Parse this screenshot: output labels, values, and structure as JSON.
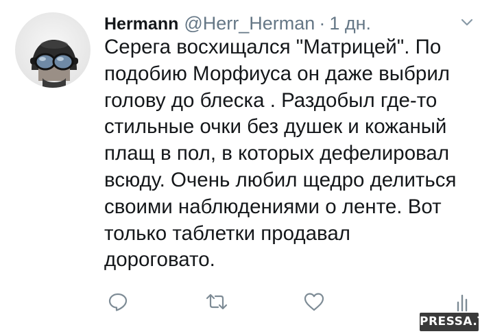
{
  "tweet": {
    "author": {
      "name": "Hermann",
      "handle": "@Herr_Herman",
      "separator": "·",
      "time": "1 дн."
    },
    "text_lines": [
      "Серега восхищался \"Матрицей\". По",
      "подобию Морфиуса он даже выбрил",
      "голову до блеска . Раздобыл где-то",
      "стильные очки без душек и кожаный",
      "плащ в пол, в которых дефелировал",
      "всюду. Очень любил щедро делиться",
      "своими наблюдениями о ленте. Вот",
      "только таблетки продавал",
      "дороговато."
    ],
    "actions": {
      "reply": "reply-icon",
      "retweet": "retweet-icon",
      "like": "heart-icon",
      "analytics": "analytics-icon"
    },
    "menu": "chevron-down-icon",
    "avatar": "avatar-helmet-goggles"
  },
  "watermark": {
    "text": "PRESSA.TV"
  },
  "colors": {
    "text": "#14171a",
    "secondary": "#657786",
    "icon": "#7d8b95",
    "watermark_bg": "#3a3a3a"
  }
}
